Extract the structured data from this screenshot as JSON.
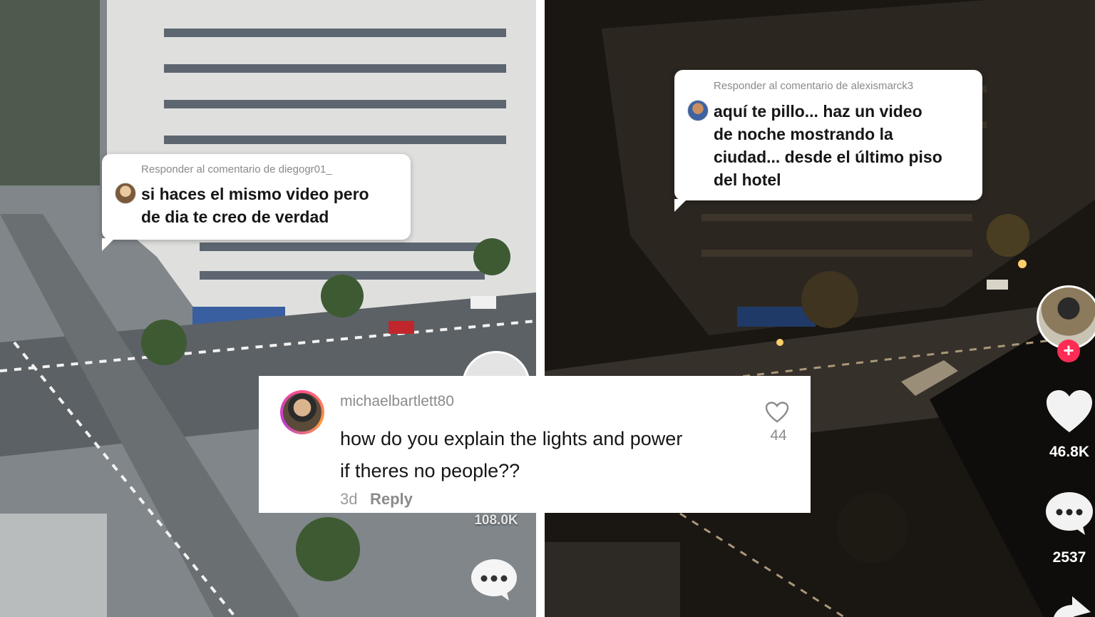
{
  "left_video": {
    "reply_header": "Responder al comentario de diegogr01_",
    "reply_text_line1": "si haces el mismo video pero",
    "reply_text_line2": "de dia te creo de verdad",
    "partial_count": "108.0K"
  },
  "right_video": {
    "reply_header": "Responder al comentario de alexismarck3",
    "reply_text_line1": "aquí te pillo... haz un video",
    "reply_text_line2": "de noche mostrando la",
    "reply_text_line3": "ciudad... desde el último piso",
    "reply_text_line4": "del hotel",
    "like_count": "46.8K",
    "comment_count": "2537"
  },
  "comment": {
    "username": "michaelbartlett80",
    "text_line1": "how do you explain the lights and power",
    "text_line2": "if theres no people??",
    "age": "3d",
    "reply_label": "Reply",
    "like_count": "44"
  },
  "colors": {
    "follow_accent": "#fe2c55",
    "day_sky": "#7d8284",
    "night_sky": "#17130f"
  }
}
